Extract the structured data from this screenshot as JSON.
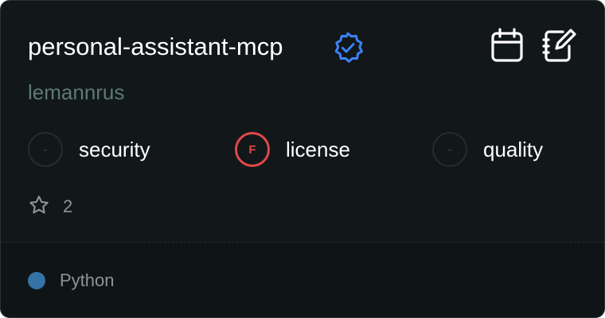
{
  "card": {
    "title": "personal-assistant-mcp",
    "verified_icon": "verified-badge-icon",
    "author": "lemannrus",
    "actions": [
      {
        "icon": "calendar-icon"
      },
      {
        "icon": "notebook-edit-icon"
      }
    ],
    "metrics": [
      {
        "grade": "-",
        "label": "security",
        "status": "none"
      },
      {
        "grade": "F",
        "label": "license",
        "status": "fail"
      },
      {
        "grade": "-",
        "label": "quality",
        "status": "none"
      }
    ],
    "stars": {
      "icon": "star-icon",
      "count": "2"
    },
    "language": {
      "name": "Python",
      "color": "#3572A5"
    }
  },
  "colors": {
    "background": "#121719",
    "footer": "#0f1416",
    "accent_blue": "#3b82f6",
    "fail_red": "#e0484a",
    "author": "#5d7b70"
  }
}
